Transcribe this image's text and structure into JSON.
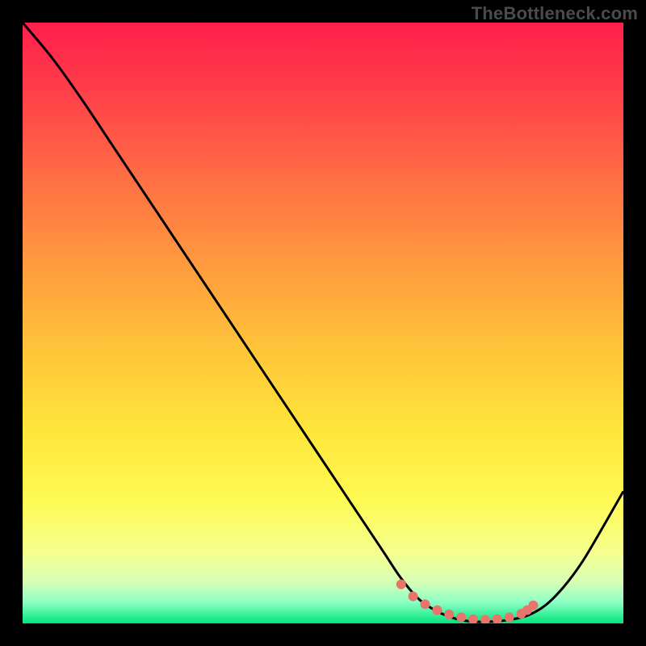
{
  "watermark": "TheBottleneck.com",
  "colors": {
    "frame": "#000000",
    "curve": "#000000",
    "markers": "#e8746b",
    "watermark": "#4b4b4b"
  },
  "chart_data": {
    "type": "line",
    "title": "",
    "xlabel": "",
    "ylabel": "",
    "xlim": [
      0,
      100
    ],
    "ylim": [
      0,
      100
    ],
    "x": [
      0,
      5,
      10,
      15,
      20,
      25,
      30,
      35,
      40,
      45,
      50,
      55,
      60,
      63,
      66,
      69,
      72,
      75,
      78,
      81,
      84,
      87,
      90,
      93,
      96,
      100
    ],
    "y": [
      100,
      94,
      87,
      79.5,
      72,
      64.5,
      57,
      49.5,
      42,
      34.5,
      27,
      19.5,
      12,
      7.5,
      4,
      2,
      0.8,
      0.3,
      0.3,
      0.6,
      1.3,
      3,
      6,
      10,
      15,
      22
    ],
    "markers": {
      "x": [
        63,
        65,
        67,
        69,
        71,
        73,
        75,
        77,
        79,
        81,
        83,
        84,
        85
      ],
      "y": [
        6.5,
        4.5,
        3.2,
        2.2,
        1.5,
        1.0,
        0.7,
        0.6,
        0.7,
        1.0,
        1.6,
        2.2,
        3.0
      ]
    },
    "gradient_stops": [
      {
        "pos": 0.0,
        "color": "#ff1f4a"
      },
      {
        "pos": 0.1,
        "color": "#ff3a4a"
      },
      {
        "pos": 0.25,
        "color": "#ff6b45"
      },
      {
        "pos": 0.4,
        "color": "#ff9a3e"
      },
      {
        "pos": 0.55,
        "color": "#ffc63a"
      },
      {
        "pos": 0.68,
        "color": "#ffe63a"
      },
      {
        "pos": 0.8,
        "color": "#fdfb55"
      },
      {
        "pos": 0.88,
        "color": "#f6ff8e"
      },
      {
        "pos": 0.93,
        "color": "#d8ffb4"
      },
      {
        "pos": 0.965,
        "color": "#8dffc4"
      },
      {
        "pos": 1.0,
        "color": "#00e57a"
      }
    ]
  }
}
